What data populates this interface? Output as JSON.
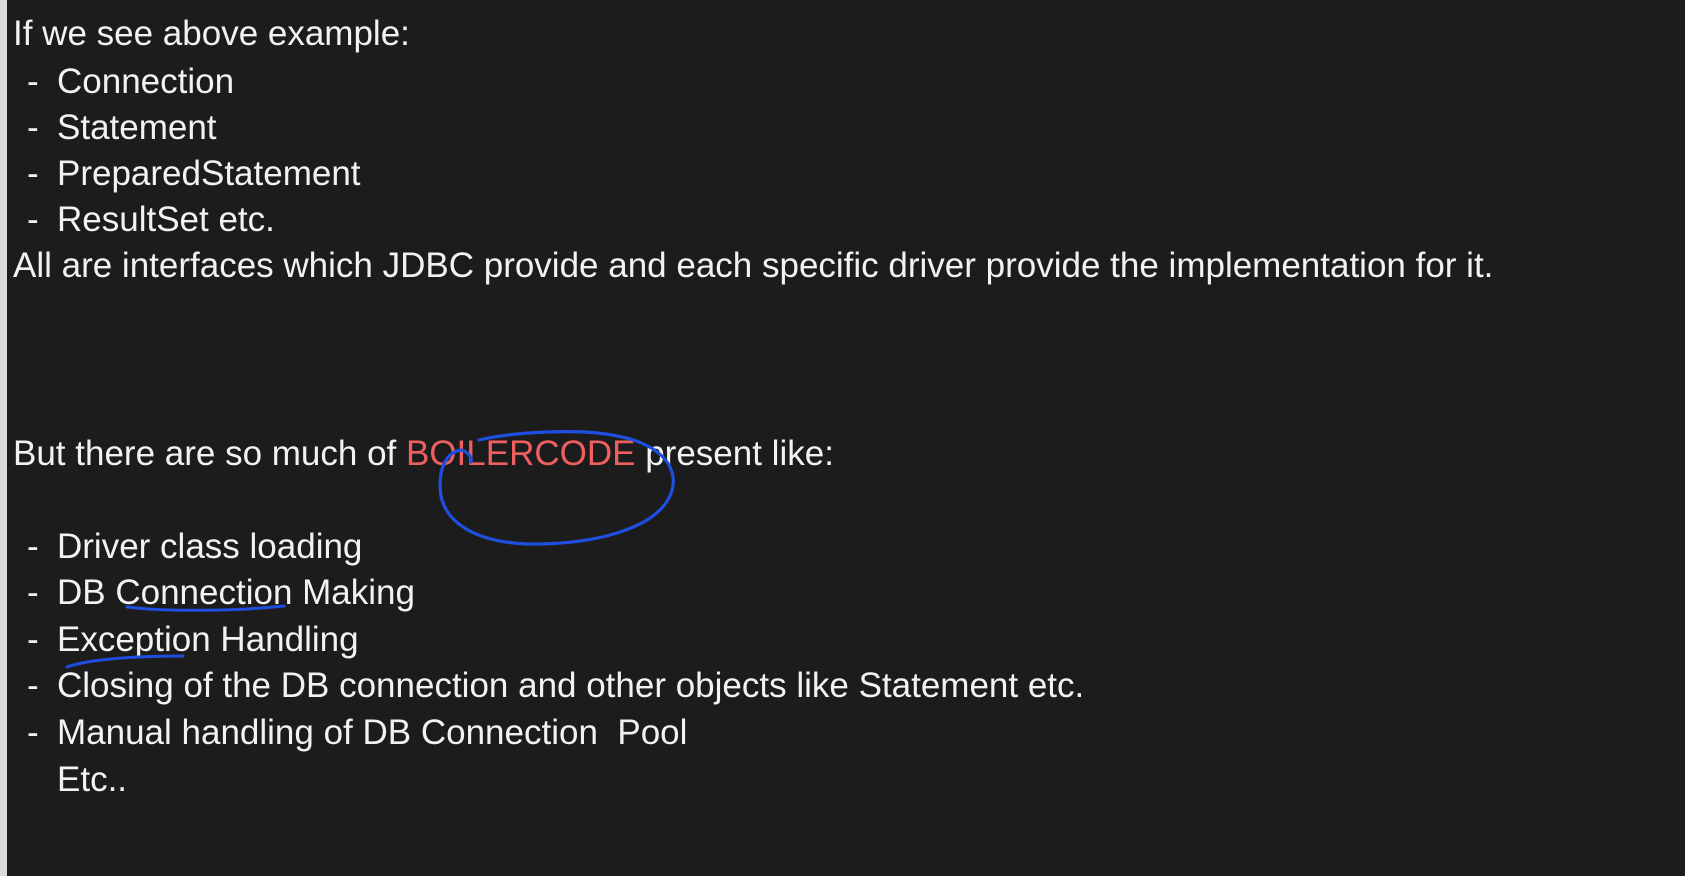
{
  "section1": {
    "intro": "If we see above example:",
    "items": [
      "Connection",
      "Statement",
      "PreparedStatement",
      "ResultSet etc."
    ],
    "summary": "All are interfaces which JDBC provide and each specific driver provide the implementation for it."
  },
  "section2": {
    "lead_before": "But there are so much of ",
    "highlight": "BOILERCODE",
    "lead_after": " present like:",
    "items": [
      "Driver class loading",
      "DB Connection Making",
      "Exception Handling",
      "Closing of the DB connection and other objects like Statement etc.",
      "Manual handling of DB Connection  Pool"
    ],
    "trailer": "Etc.."
  },
  "bullet_symbol": "-",
  "colors": {
    "background": "#1c1c1c",
    "text": "#f2f2f2",
    "highlight_text": "#ef5f5f",
    "ink_annotation": "#1f4fe0"
  }
}
